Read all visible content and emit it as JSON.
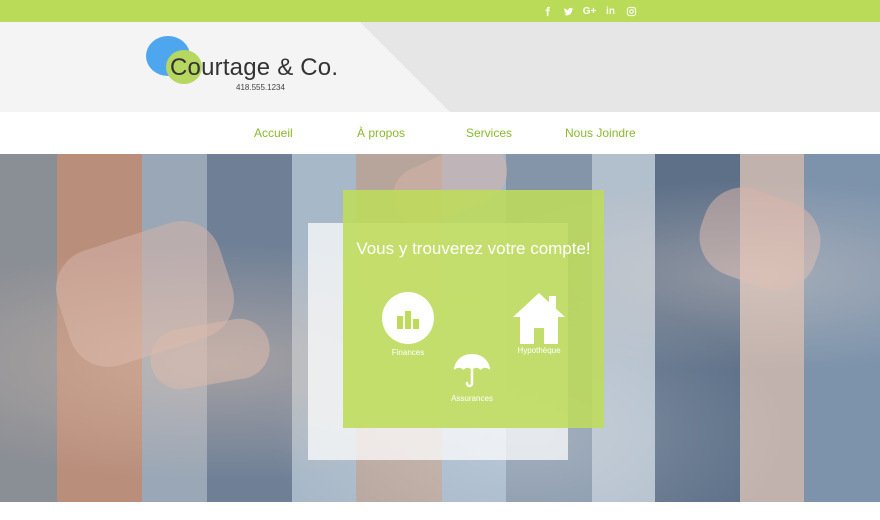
{
  "social": {
    "icons": [
      "facebook-icon",
      "twitter-icon",
      "google-plus-icon",
      "linkedin-icon",
      "instagram-icon"
    ],
    "google_plus_label": "G+",
    "linkedin_label": "in"
  },
  "header": {
    "brand": "Courtage & Co.",
    "phone": "418.555.1234"
  },
  "nav": {
    "items": [
      "Accueil",
      "À propos",
      "Services",
      "Nous Joindre"
    ]
  },
  "hero": {
    "title": "Vous y trouverez votre compte!",
    "services": {
      "finances": "Finances",
      "assurances": "Assurances",
      "hypotheque": "Hypothèque"
    }
  },
  "colors": {
    "accent": "#b9db58",
    "nav_text": "#8cb82e",
    "logo_blue": "#4ea6ef",
    "logo_green": "#b6d860"
  }
}
